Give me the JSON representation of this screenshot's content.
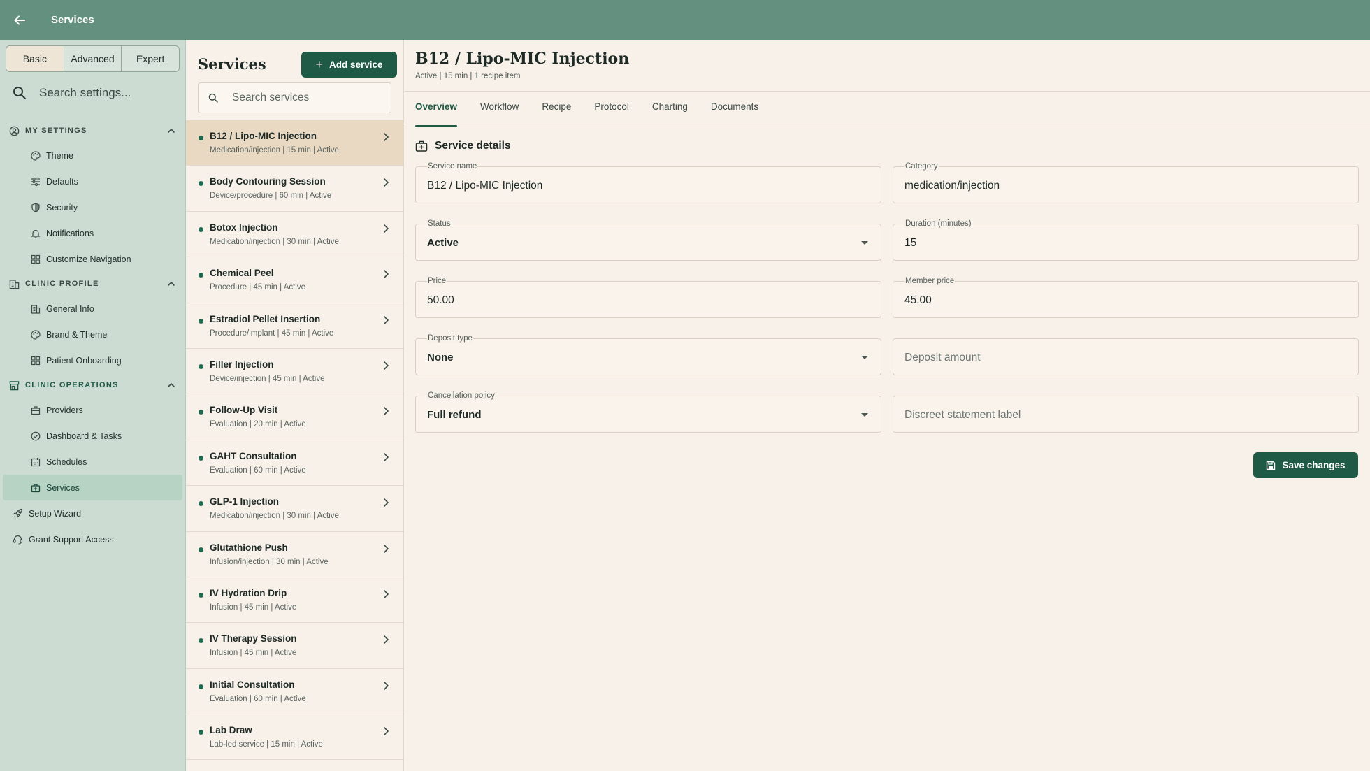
{
  "topbar": {
    "title": "Services",
    "back_icon": "arrow-left-icon"
  },
  "sidebar": {
    "modes": [
      "Basic",
      "Advanced",
      "Expert"
    ],
    "active_mode": "Basic",
    "search_placeholder": "Search settings...",
    "sections": [
      {
        "label": "MY SETTINGS",
        "icon": "user-circle-icon",
        "items": [
          {
            "label": "Theme",
            "icon": "palette-icon"
          },
          {
            "label": "Defaults",
            "icon": "sliders-icon"
          },
          {
            "label": "Security",
            "icon": "shield-icon"
          },
          {
            "label": "Notifications",
            "icon": "bell-icon"
          },
          {
            "label": "Customize Navigation",
            "icon": "grid-icon"
          }
        ]
      },
      {
        "label": "CLINIC PROFILE",
        "icon": "building-icon",
        "items": [
          {
            "label": "General Info",
            "icon": "building-icon"
          },
          {
            "label": "Brand & Theme",
            "icon": "palette-icon"
          },
          {
            "label": "Patient Onboarding",
            "icon": "grid-icon"
          }
        ]
      },
      {
        "label": "CLINIC OPERATIONS",
        "icon": "store-icon",
        "items": [
          {
            "label": "Providers",
            "icon": "briefcase-icon"
          },
          {
            "label": "Dashboard & Tasks",
            "icon": "check-circle-icon"
          },
          {
            "label": "Schedules",
            "icon": "calendar-icon"
          },
          {
            "label": "Services",
            "icon": "medical-bag-icon"
          }
        ]
      }
    ],
    "top_items": [
      {
        "label": "Setup Wizard",
        "icon": "rocket-icon"
      },
      {
        "label": "Grant Support Access",
        "icon": "headset-icon"
      }
    ]
  },
  "list": {
    "title": "Services",
    "add_label": "Add service",
    "search_placeholder": "Search services",
    "items": [
      {
        "name": "B12 / Lipo-MIC Injection",
        "meta": "Medication/injection  |  15 min  |  Active"
      },
      {
        "name": "Body Contouring Session",
        "meta": "Device/procedure  |  60 min  |  Active"
      },
      {
        "name": "Botox Injection",
        "meta": "Medication/injection  |  30 min  |  Active"
      },
      {
        "name": "Chemical Peel",
        "meta": "Procedure  |  45 min  |  Active"
      },
      {
        "name": "Estradiol Pellet Insertion",
        "meta": "Procedure/implant  |  45 min  |  Active"
      },
      {
        "name": "Filler Injection",
        "meta": "Device/injection  |  45 min  |  Active"
      },
      {
        "name": "Follow-Up Visit",
        "meta": "Evaluation  |  20 min  |  Active"
      },
      {
        "name": "GAHT Consultation",
        "meta": "Evaluation  |  60 min  |  Active"
      },
      {
        "name": "GLP-1 Injection",
        "meta": "Medication/injection  |  30 min  |  Active"
      },
      {
        "name": "Glutathione Push",
        "meta": "Infusion/injection  |  30 min  |  Active"
      },
      {
        "name": "IV Hydration Drip",
        "meta": "Infusion  |  45 min  |  Active"
      },
      {
        "name": "IV Therapy Session",
        "meta": "Infusion  |  45 min  |  Active"
      },
      {
        "name": "Initial Consultation",
        "meta": "Evaluation  |  60 min  |  Active"
      },
      {
        "name": "Lab Draw",
        "meta": "Lab-led service  |  15 min  |  Active"
      }
    ]
  },
  "detail": {
    "title": "B12 / Lipo-MIC Injection",
    "subtitle": "Active  |  15 min  |  1 recipe item",
    "tabs": [
      "Overview",
      "Workflow",
      "Recipe",
      "Protocol",
      "Charting",
      "Documents"
    ],
    "active_tab": "Overview",
    "section_title": "Service details",
    "fields": {
      "service_name": {
        "label": "Service name",
        "value": "B12 / Lipo-MIC Injection"
      },
      "category": {
        "label": "Category",
        "value": "medication/injection"
      },
      "status": {
        "label": "Status",
        "value": "Active"
      },
      "duration": {
        "label": "Duration (minutes)",
        "value": "15"
      },
      "price": {
        "label": "Price",
        "value": "50.00"
      },
      "member_price": {
        "label": "Member price",
        "value": "45.00"
      },
      "deposit_type": {
        "label": "Deposit type",
        "value": "None"
      },
      "deposit_amount": {
        "placeholder": "Deposit amount"
      },
      "cancellation_policy": {
        "label": "Cancellation policy",
        "value": "Full refund"
      },
      "statement_label": {
        "placeholder": "Discreet statement label"
      }
    },
    "save_label": "Save changes"
  },
  "colors": {
    "topbar": "#64917f",
    "accent": "#1f5a47",
    "sidebar": "#cddcd2",
    "background": "#f8f1e9",
    "status_dot": "#1f6a50"
  }
}
